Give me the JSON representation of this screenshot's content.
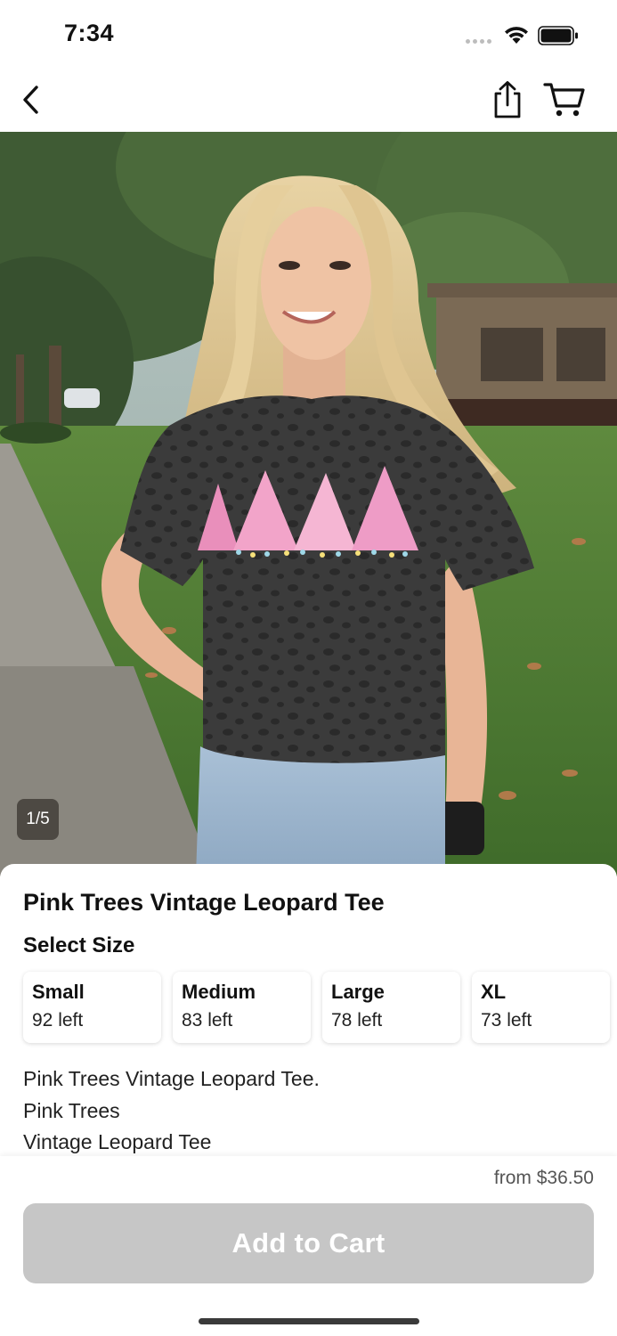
{
  "status_bar": {
    "time": "7:34",
    "icons": [
      "signal-icon",
      "wifi-icon",
      "battery-icon"
    ]
  },
  "nav": {
    "back_icon": "chevron-left-icon",
    "share_icon": "share-icon",
    "cart_icon": "cart-icon"
  },
  "gallery": {
    "image_description": "product-photo",
    "pager": "1/5"
  },
  "product": {
    "title": "Pink Trees Vintage Leopard Tee",
    "select_size_label": "Select Size",
    "sizes": [
      {
        "name": "Small",
        "stock": "92 left"
      },
      {
        "name": "Medium",
        "stock": "83 left"
      },
      {
        "name": "Large",
        "stock": "78 left"
      },
      {
        "name": "XL",
        "stock": "73 left"
      }
    ],
    "description_lines": [
      "Pink Trees Vintage Leopard Tee.",
      "Pink Trees",
      "Vintage Leopard Tee"
    ]
  },
  "purchase": {
    "price": "from $36.50",
    "add_to_cart_label": "Add to Cart"
  },
  "colors": {
    "button_disabled": "#c6c6c6",
    "text_primary": "#111111",
    "pager_bg": "#3c3732"
  }
}
